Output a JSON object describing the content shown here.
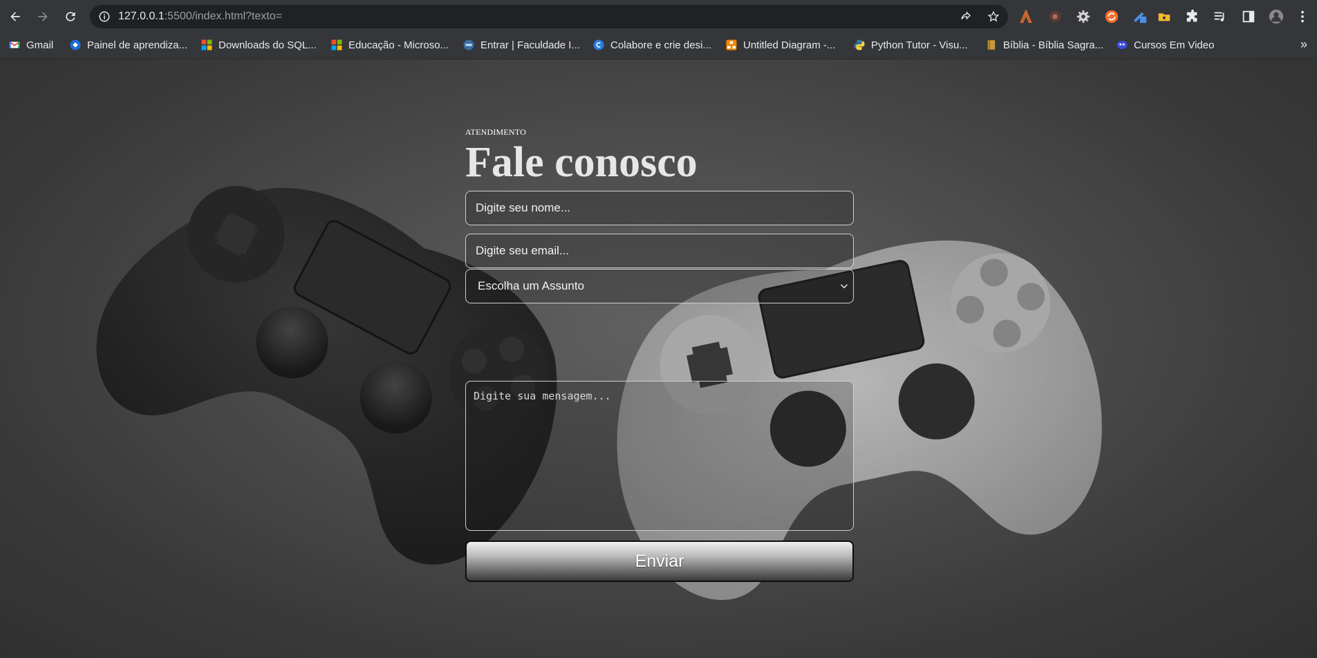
{
  "browser": {
    "url_host": "127.0.0.1",
    "url_rest": ":5500/index.html?texto="
  },
  "bookmarks": [
    {
      "label": "Gmail",
      "icon": "gmail-icon"
    },
    {
      "label": "Painel de aprendiza...",
      "icon": "learning-panel-icon"
    },
    {
      "label": "Downloads do SQL...",
      "icon": "microsoft-icon"
    },
    {
      "label": "Educação - Microso...",
      "icon": "microsoft-icon"
    },
    {
      "label": "Entrar | Faculdade I...",
      "icon": "faculdade-icon"
    },
    {
      "label": "Colabore e crie desi...",
      "icon": "canva-icon"
    },
    {
      "label": "Untitled Diagram -...",
      "icon": "diagram-icon"
    },
    {
      "label": "Python Tutor - Visu...",
      "icon": "python-icon"
    },
    {
      "label": "Bíblia - Bíblia Sagra...",
      "icon": "bible-icon"
    },
    {
      "label": "Cursos Em Video",
      "icon": "cursos-em-video-icon"
    }
  ],
  "page": {
    "eyebrow": "ATENDIMENTO",
    "title": "Fale conosco",
    "name_placeholder": "Digite seu nome...",
    "email_placeholder": "Digite seu email...",
    "subject_selected": "Escolha um Assunto",
    "message_placeholder": "Digite sua mensagem...",
    "submit_label": "Enviar"
  },
  "colors": {
    "chrome_bg": "#35363a",
    "omnibox_bg": "#202124",
    "page_text": "#ffffff"
  }
}
